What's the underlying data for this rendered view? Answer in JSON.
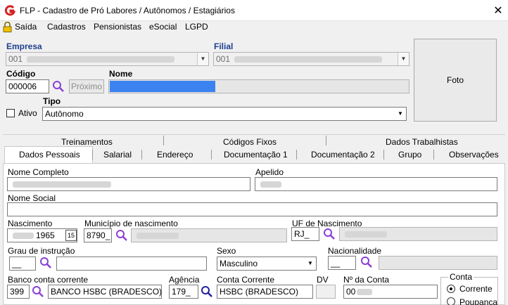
{
  "window": {
    "title": "FLP - Cadastro de Pró Labores / Autônomos / Estagiários",
    "close_icon": "✕"
  },
  "menu": {
    "saida": "Saída",
    "items": [
      "Cadastros",
      "Pensionistas",
      "eSocial",
      "LGPD"
    ]
  },
  "header": {
    "empresa_label": "Empresa",
    "empresa_value": "001",
    "filial_label": "Filial",
    "filial_value": "001",
    "codigo_label": "Código",
    "codigo_value": "000006",
    "proximo_label": "Próximo",
    "nome_label": "Nome",
    "ativo_label": "Ativo",
    "tipo_label": "Tipo",
    "tipo_value": "Autônomo",
    "foto_label": "Foto"
  },
  "tabs_row1": [
    "Treinamentos",
    "Códigos Fixos",
    "Dados Trabalhistas"
  ],
  "tabs_row2": [
    "Dados Pessoais",
    "Salarial",
    "Endereço",
    "Documentação 1",
    "Documentação 2",
    "Grupo",
    "Observações"
  ],
  "form": {
    "nome_completo_label": "Nome Completo",
    "apelido_label": "Apelido",
    "nome_social_label": "Nome Social",
    "nascimento_label": "Nascimento",
    "nascimento_value": "1965",
    "municipio_label": "Município de nascimento",
    "municipio_value": "8790_",
    "uf_label": "UF de Nascimento",
    "uf_value": "RJ_",
    "grau_label": "Grau de instrução",
    "grau_value": "__",
    "sexo_label": "Sexo",
    "sexo_value": "Masculino",
    "nacionalidade_label": "Nacionalidade",
    "nacionalidade_value": "__",
    "banco_label": "Banco conta corrente",
    "banco_code": "399",
    "banco_name": "BANCO HSBC (BRADESCO)",
    "agencia_label": "Agência",
    "agencia_value": "179_",
    "conta_corrente_label": "Conta Corrente",
    "conta_corrente_value": "HSBC (BRADESCO)",
    "dv_label": "DV",
    "nconta_label": "Nº da Conta",
    "nconta_value": "00",
    "conta_group_label": "Conta",
    "conta_options": [
      "Corrente",
      "Poupança"
    ],
    "conta_selected": "Corrente"
  }
}
